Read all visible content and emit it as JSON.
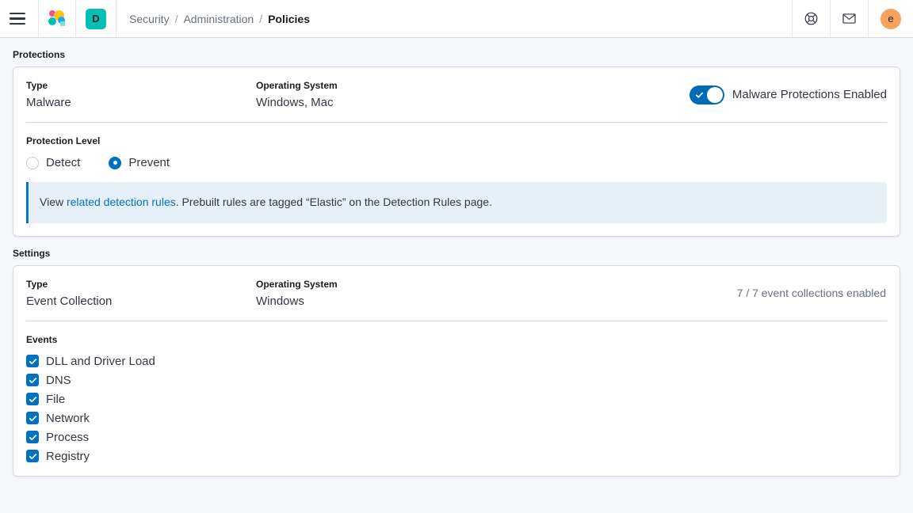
{
  "header": {
    "menu_icon": "hamburger-menu-icon",
    "logo_icon": "elastic-logo-icon",
    "space_avatar_letter": "D",
    "breadcrumb": [
      {
        "label": "Security",
        "active": false
      },
      {
        "label": "Administration",
        "active": false
      },
      {
        "label": "Policies",
        "active": true
      }
    ],
    "separator": "/",
    "help_icon": "help-lifering-icon",
    "mail_icon": "mail-envelope-icon",
    "user_avatar_letter": "e",
    "accent_teal": "#00bfb3",
    "accent_orange": "#f5a35c"
  },
  "protections": {
    "section_label": "Protections",
    "type_label": "Type",
    "type_value": "Malware",
    "os_label": "Operating System",
    "os_value": "Windows, Mac",
    "toggle_label": "Malware Protections Enabled",
    "toggle_on": true,
    "toggle_color": "#006bb4",
    "protection_level_label": "Protection Level",
    "levels": [
      {
        "label": "Detect",
        "selected": false
      },
      {
        "label": "Prevent",
        "selected": true
      }
    ],
    "callout": {
      "prefix": "View ",
      "link": "related detection rules",
      "suffix": ". Prebuilt rules are tagged “Elastic” on the Detection Rules page.",
      "accent": "#0077cc",
      "background": "#e6f0f8"
    }
  },
  "settings": {
    "section_label": "Settings",
    "type_label": "Type",
    "type_value": "Event Collection",
    "os_label": "Operating System",
    "os_value": "Windows",
    "status": "7 / 7 event collections enabled",
    "events_title": "Events",
    "events": [
      {
        "label": "DLL and Driver Load",
        "checked": true
      },
      {
        "label": "DNS",
        "checked": true
      },
      {
        "label": "File",
        "checked": true
      },
      {
        "label": "Network",
        "checked": true
      },
      {
        "label": "Process",
        "checked": true
      },
      {
        "label": "Registry",
        "checked": true
      }
    ],
    "checkbox_color": "#0071c2"
  }
}
